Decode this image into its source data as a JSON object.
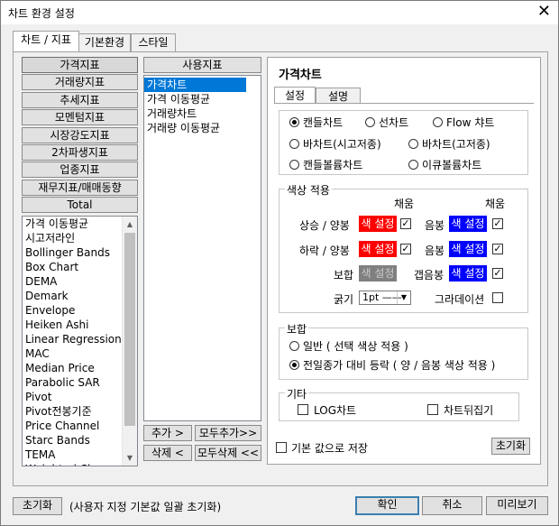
{
  "window": {
    "title": "차트 환경 설정",
    "close": "✕"
  },
  "tabs": [
    {
      "label": "차트 / 지표"
    },
    {
      "label": "기본환경"
    },
    {
      "label": "스타일"
    }
  ],
  "categories": [
    "가격지표",
    "거래량지표",
    "추세지표",
    "모멘텀지표",
    "시장강도지표",
    "2차파생지표",
    "업종지표",
    "재무지표/매매동향",
    "Total"
  ],
  "indicator_list": [
    "가격 이동평균",
    "시고저라인",
    "Bollinger Bands",
    "Box Chart",
    "DEMA",
    "Demark",
    "Envelope",
    "Heiken Ashi",
    "Linear Regression ...",
    "MAC",
    "Median Price",
    "Parabolic SAR",
    "Pivot",
    "Pivot전봉기준",
    "Price Channel",
    "Starc Bands",
    "TEMA",
    "Weighted Close"
  ],
  "used": {
    "header": "사용지표",
    "items": [
      "가격차트",
      "가격 이동평균",
      "거래량차트",
      "거래량 이동평균"
    ],
    "selected": 0
  },
  "list_buttons": {
    "add": "추가 >",
    "add_all": "모두추가>>",
    "remove": "삭제 <",
    "remove_all": "모두삭제 <<"
  },
  "right": {
    "title": "가격차트",
    "subtabs": [
      "설정",
      "설명"
    ],
    "chart_types": [
      {
        "label": "캔들차트",
        "selected": true
      },
      {
        "label": "선차트",
        "selected": false
      },
      {
        "label": "Flow 챠트",
        "selected": false
      },
      {
        "label": "바차트(시고저종)",
        "selected": false
      },
      {
        "label": "바차트(고저종)",
        "selected": false
      },
      {
        "label": "캔들볼륨차트",
        "selected": false
      },
      {
        "label": "이큐볼륨차트",
        "selected": false
      }
    ],
    "color_group": {
      "legend": "색상 적용",
      "fill_header": "채움",
      "fill_header2": "채움",
      "rise_label": "상승 / 양봉",
      "fall_label": "하락 / 양봉",
      "flat_label": "보합",
      "neg_label": "음봉",
      "neg2_label": "음봉",
      "gap_label": "갭음봉",
      "btn_label": "색 설정",
      "thick_label": "굵기",
      "thick_value": "1pt ——",
      "gradient_label": "그라데이션",
      "colors": {
        "red": "#ff0000",
        "blue": "#0000ff",
        "gray": "#808080"
      }
    },
    "flat_group": {
      "legend": "보합",
      "opt1": "일반 ( 선택 색상 적용 )",
      "opt2": "전일종가 대비 등락 ( 양 / 음봉 색상 적용 )"
    },
    "etc_group": {
      "legend": "기타",
      "log": "LOG차트",
      "flip": "차트뒤집기"
    },
    "save_default": "기본 값으로 저장",
    "reset": "초기화"
  },
  "footer": {
    "reset": "초기화",
    "note": "(사용자 지정 기본값 일괄 초기화)",
    "ok": "확인",
    "cancel": "취소",
    "preview": "미리보기"
  }
}
